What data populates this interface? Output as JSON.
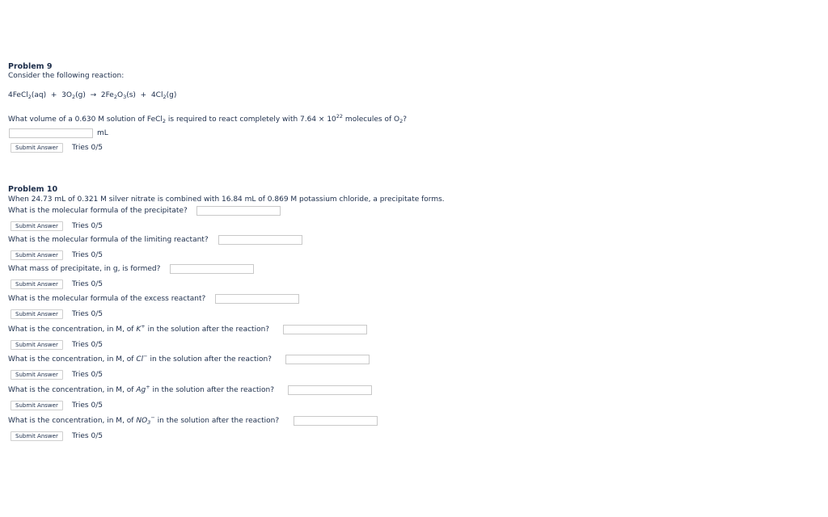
{
  "common": {
    "submit_label": "Submit Answer",
    "tries": "Tries 0/5"
  },
  "problem9": {
    "title": "Problem 9",
    "intro": "Consider the following reaction:",
    "reaction": {
      "r1_coef": "4FeCl",
      "r1_sub": "2",
      "r1_state": "(aq)",
      "plus1": "+",
      "r2_coef": "3O",
      "r2_sub": "2",
      "r2_state": "(g)",
      "arrow": "→",
      "p1_coef": "2Fe",
      "p1_sub1": "2",
      "p1_mid": "O",
      "p1_sub2": "3",
      "p1_state": "(s)",
      "plus2": "+",
      "p2_coef": "4Cl",
      "p2_sub": "2",
      "p2_state": "(g)"
    },
    "question": {
      "part1": "What volume of a 0.630 M solution of FeCl",
      "sub1": "2",
      "part2": " is required to react completely with 7.64 × 10",
      "sup1": "22",
      "part3": " molecules of O",
      "sub2": "2",
      "part4": "?"
    },
    "unit": "mL",
    "answer_value": ""
  },
  "problem10": {
    "title": "Problem 10",
    "intro": "When 24.73 mL of 0.321 M silver nitrate is combined with 16.84 mL of 0.869 M potassium chloride, a precipitate forms.",
    "q1": "What is the molecular formula of the precipitate?",
    "q2": "What is the molecular formula of the limiting reactant?",
    "q3": "What mass of precipitate, in g, is formed?",
    "q4": "What is the molecular formula of the excess reactant?",
    "q5": {
      "pre": "What is the concentration, in M, of ",
      "ion": "K",
      "charge": "+",
      "post": " in the solution after the reaction?"
    },
    "q6": {
      "pre": "What is the concentration, in M, of ",
      "ion": "Cl",
      "charge": "−",
      "post": " in the solution after the reaction?"
    },
    "q7": {
      "pre": "What is the concentration, in M, of ",
      "ion": "Ag",
      "charge": "+",
      "post": " in the solution after the reaction?"
    },
    "q8": {
      "pre": "What is the concentration, in M, of ",
      "ion": "NO",
      "sub": "3",
      "charge": "−",
      "post": " in the solution after the reaction?"
    }
  }
}
